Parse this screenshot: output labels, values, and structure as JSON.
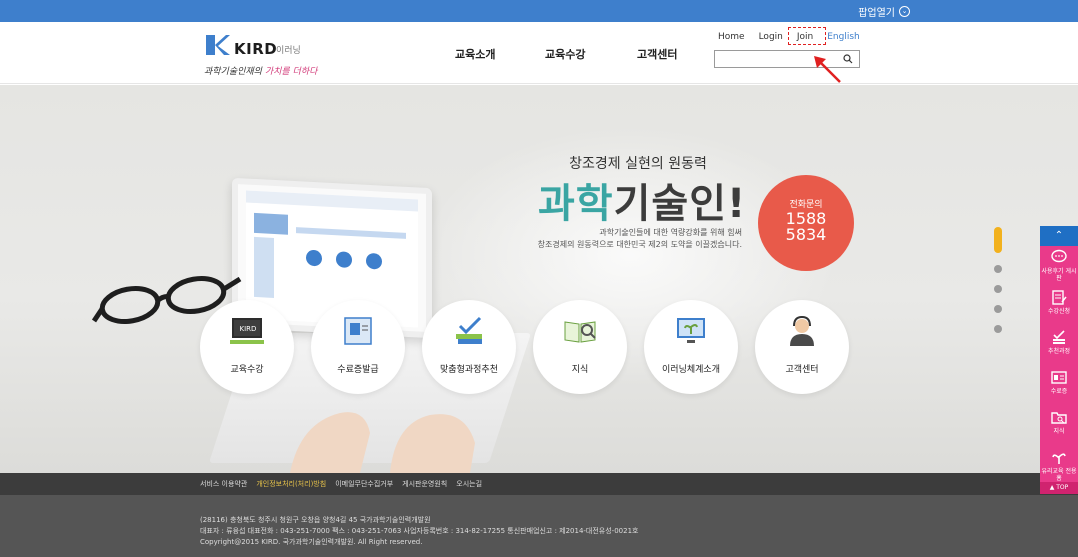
{
  "topbar": {
    "popup_label": "팝업열기"
  },
  "logo": {
    "brand": "KIRD",
    "sub": "이러닝",
    "tagline_a": "과학기술인재의 ",
    "tagline_b": "가치를",
    "tagline_c": " 더하다",
    "color_primary": "#3e7fcc"
  },
  "nav": {
    "items": [
      "교육소개",
      "교육수강",
      "고객센터"
    ]
  },
  "util": {
    "home": "Home",
    "login": "Login",
    "join": "Join",
    "english": "English"
  },
  "search": {
    "placeholder": ""
  },
  "hero": {
    "title": "창조경제 실현의 원동력",
    "big_accent": "과학",
    "big_rest": "기술인!",
    "desc_line1": "과학기술인들에 대한 역량강화를 위해 힘써",
    "desc_line2": "창조경제의 원동력으로 대한민국 제2의 도약을 이끌겠습니다.",
    "phone_label": "전화문의",
    "phone_line1": "1588",
    "phone_line2": "5834"
  },
  "cards": [
    {
      "label": "교육수강",
      "icon": "blackboard-icon"
    },
    {
      "label": "수료증발급",
      "icon": "certificate-icon"
    },
    {
      "label": "맞춤형과정추천",
      "icon": "books-check-icon"
    },
    {
      "label": "지식",
      "icon": "book-magnifier-icon"
    },
    {
      "label": "이러닝체계소개",
      "icon": "monitor-plant-icon"
    },
    {
      "label": "고객센터",
      "icon": "headset-agent-icon"
    }
  ],
  "footer": {
    "links": [
      "서비스 이용약관",
      "개인정보처리(처리)방침",
      "이메일무단수집거부",
      "게시판운영원칙",
      "오시는길"
    ],
    "address": "(28116) 충청북도 청주시 청원구 오창읍 양청4길 45 국가과학기술인력개발원",
    "contact": "대표자 : 류융섭 대표전화 : 043-251-7000 팩스 : 043-251-7063 사업자등록번호 : 314-82-17255 통신판매업신고 : 제2014-대전유성-0021호",
    "copyright": "Copyright@2015 KIRD. 국가과학기술인력개발원. All Right reserved."
  },
  "quick": {
    "items": [
      "사용후기 게시판",
      "수강신청",
      "추천과정",
      "수료증",
      "지식",
      "유리교육 전용홈"
    ],
    "top": "▲ TOP",
    "color": "#e93a8a"
  }
}
